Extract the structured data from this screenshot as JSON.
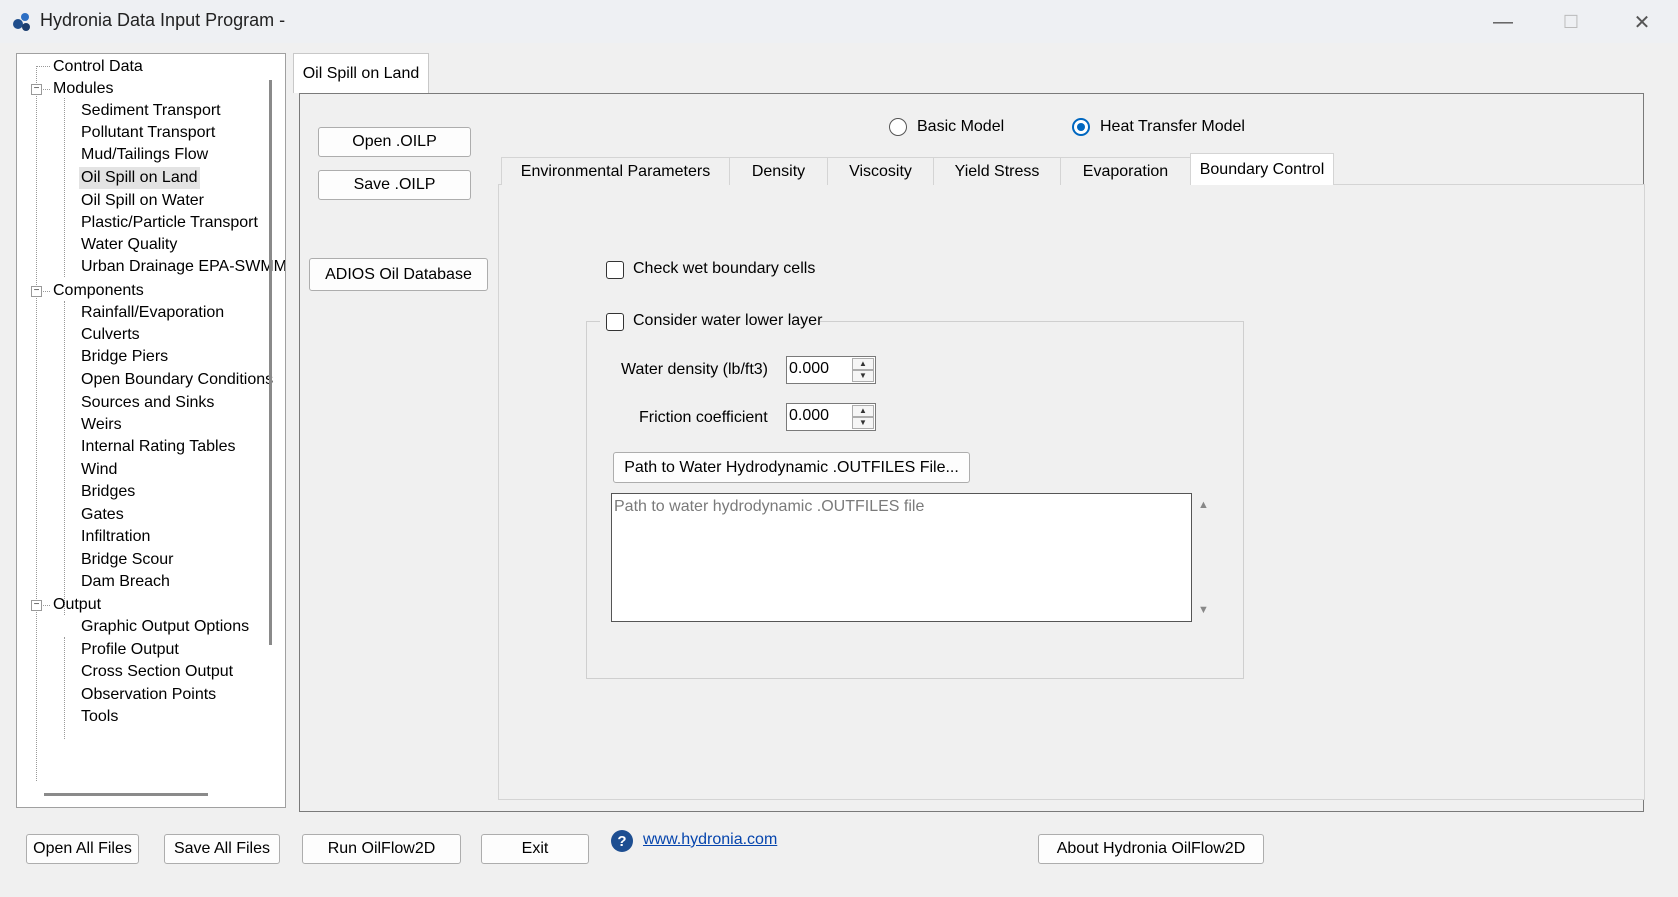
{
  "window": {
    "title": "Hydronia Data Input Program -",
    "controls": {
      "minimize": "—",
      "maximize": "☐",
      "close": "✕"
    }
  },
  "tree": {
    "items": [
      {
        "label": "Control Data"
      },
      {
        "label": "Modules"
      },
      {
        "label": "Sediment Transport"
      },
      {
        "label": "Pollutant Transport"
      },
      {
        "label": "Mud/Tailings Flow"
      },
      {
        "label": "Oil Spill on Land"
      },
      {
        "label": "Oil Spill on Water"
      },
      {
        "label": "Plastic/Particle Transport"
      },
      {
        "label": "Water Quality"
      },
      {
        "label": "Urban Drainage EPA-SWMM"
      },
      {
        "label": "Components"
      },
      {
        "label": "Rainfall/Evaporation"
      },
      {
        "label": "Culverts"
      },
      {
        "label": "Bridge Piers"
      },
      {
        "label": "Open Boundary Conditions"
      },
      {
        "label": "Sources and Sinks"
      },
      {
        "label": "Weirs"
      },
      {
        "label": "Internal Rating Tables"
      },
      {
        "label": "Wind"
      },
      {
        "label": "Bridges"
      },
      {
        "label": "Gates"
      },
      {
        "label": "Infiltration"
      },
      {
        "label": "Bridge Scour"
      },
      {
        "label": "Dam Breach"
      },
      {
        "label": "Output"
      },
      {
        "label": "Graphic Output Options"
      },
      {
        "label": "Profile Output"
      },
      {
        "label": "Cross Section Output"
      },
      {
        "label": "Observation Points"
      },
      {
        "label": "Tools"
      }
    ],
    "expander_symbol": "−"
  },
  "main_tab": {
    "label": "Oil Spill on Land"
  },
  "buttons": {
    "open_oilp": "Open .OILP",
    "save_oilp": "Save .OILP",
    "adios": "ADIOS Oil Database"
  },
  "model": {
    "basic": "Basic Model",
    "heat": "Heat Transfer Model",
    "selected": "Heat Transfer Model"
  },
  "subtabs": [
    {
      "label": "Environmental Parameters"
    },
    {
      "label": "Density"
    },
    {
      "label": "Viscosity"
    },
    {
      "label": "Yield Stress"
    },
    {
      "label": "Evaporation"
    },
    {
      "label": "Boundary Control"
    }
  ],
  "boundary": {
    "check_wet": "Check wet boundary cells",
    "consider_lower": "Consider water lower layer",
    "water_density_label": "Water density (lb/ft3)",
    "water_density_value": "0.000",
    "friction_label": "Friction coefficient",
    "friction_value": "0.000",
    "path_button": "Path to Water Hydrodynamic .OUTFILES  File...",
    "path_placeholder": "Path to water hydrodynamic .OUTFILES file"
  },
  "footer": {
    "open_all": "Open All Files",
    "save_all": "Save All Files",
    "run": "Run OilFlow2D",
    "exit": "Exit",
    "help_icon": "?",
    "website": "www.hydronia.com",
    "about": "About Hydronia OilFlow2D"
  },
  "colors": {
    "accent": "#0067c0",
    "link": "#0645ad"
  }
}
